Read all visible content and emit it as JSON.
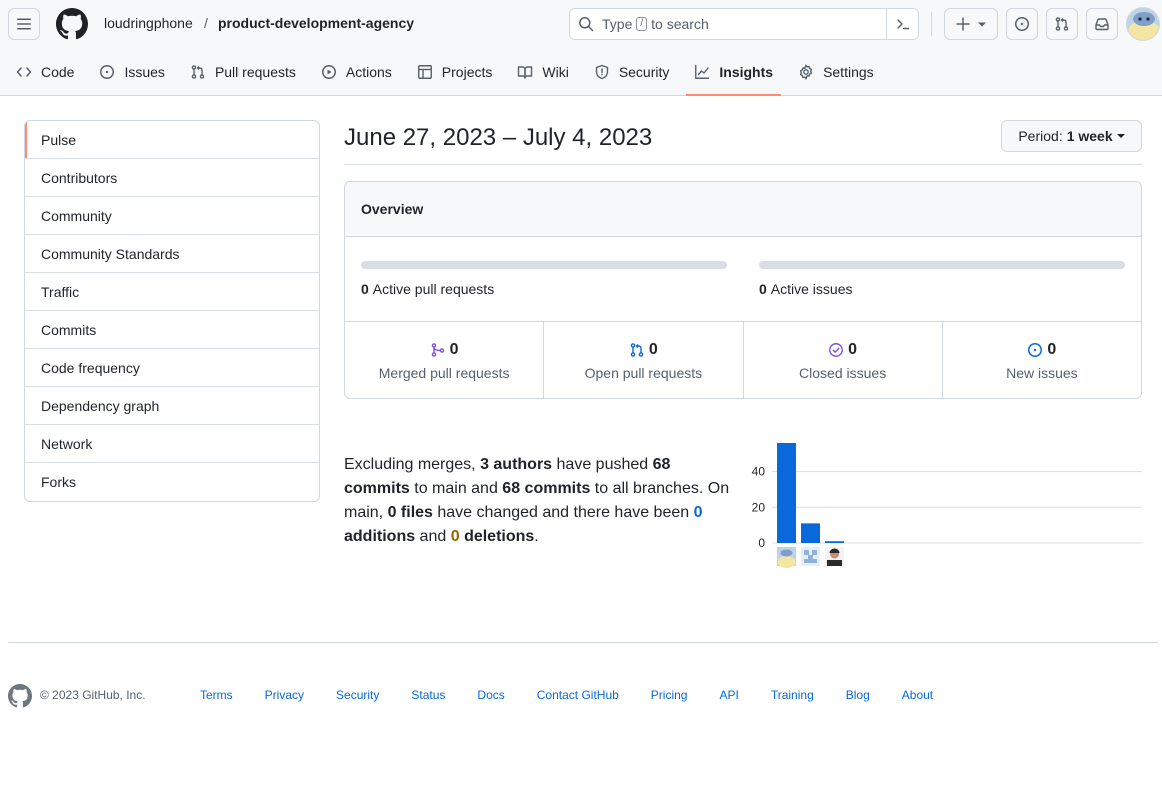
{
  "header": {
    "owner": "loudringphone",
    "separator": "/",
    "repo": "product-development-agency",
    "search_prefix": "Type",
    "search_key": "/",
    "search_suffix": "to search"
  },
  "nav": [
    {
      "label": "Code",
      "icon": "code-icon"
    },
    {
      "label": "Issues",
      "icon": "issue-opened-icon"
    },
    {
      "label": "Pull requests",
      "icon": "git-pull-request-icon"
    },
    {
      "label": "Actions",
      "icon": "play-icon"
    },
    {
      "label": "Projects",
      "icon": "table-icon"
    },
    {
      "label": "Wiki",
      "icon": "book-icon"
    },
    {
      "label": "Security",
      "icon": "shield-icon"
    },
    {
      "label": "Insights",
      "icon": "graph-icon",
      "active": true
    },
    {
      "label": "Settings",
      "icon": "gear-icon"
    }
  ],
  "sidebar": {
    "items": [
      {
        "label": "Pulse",
        "active": true
      },
      {
        "label": "Contributors"
      },
      {
        "label": "Community"
      },
      {
        "label": "Community Standards"
      },
      {
        "label": "Traffic"
      },
      {
        "label": "Commits"
      },
      {
        "label": "Code frequency"
      },
      {
        "label": "Dependency graph"
      },
      {
        "label": "Network"
      },
      {
        "label": "Forks"
      }
    ]
  },
  "main": {
    "date_range": "June 27, 2023 – July 4, 2023",
    "period_label": "Period:",
    "period_value": "1 week",
    "overview": {
      "title": "Overview",
      "active_prs_count": "0",
      "active_prs_label": "Active pull requests",
      "active_issues_count": "0",
      "active_issues_label": "Active issues",
      "stats": [
        {
          "count": "0",
          "label": "Merged pull requests",
          "icon": "git-merge-icon",
          "color": "#8250df"
        },
        {
          "count": "0",
          "label": "Open pull requests",
          "icon": "git-pull-request-icon",
          "color": "#0969da"
        },
        {
          "count": "0",
          "label": "Closed issues",
          "icon": "check-circle-icon",
          "color": "#8250df"
        },
        {
          "count": "0",
          "label": "New issues",
          "icon": "issue-opened-icon",
          "color": "#0969da"
        }
      ]
    },
    "summary": {
      "t1": "Excluding merges, ",
      "authors": "3 authors",
      "t2": " have pushed ",
      "commits_main_n": "68",
      "commits_main_w": "commits",
      "t3": " to main and ",
      "commits_all": "68 commits",
      "t4": " to all branches. On main, ",
      "files": "0 files",
      "t5": " have changed and there have been ",
      "additions_n": "0",
      "additions_w": "additions",
      "t6": " and ",
      "deletions_n": "0",
      "deletions_w": "deletions",
      "t7": "."
    }
  },
  "chart_data": {
    "type": "bar",
    "categories": [
      "author-1",
      "author-2",
      "author-3"
    ],
    "values": [
      56,
      11,
      1
    ],
    "ylim": [
      0,
      56
    ],
    "yticks": [
      "40",
      "20",
      "0"
    ],
    "color": "#0969da"
  },
  "footer": {
    "copyright": "© 2023 GitHub, Inc.",
    "links": [
      "Terms",
      "Privacy",
      "Security",
      "Status",
      "Docs",
      "Contact GitHub",
      "Pricing",
      "API",
      "Training",
      "Blog",
      "About"
    ]
  }
}
